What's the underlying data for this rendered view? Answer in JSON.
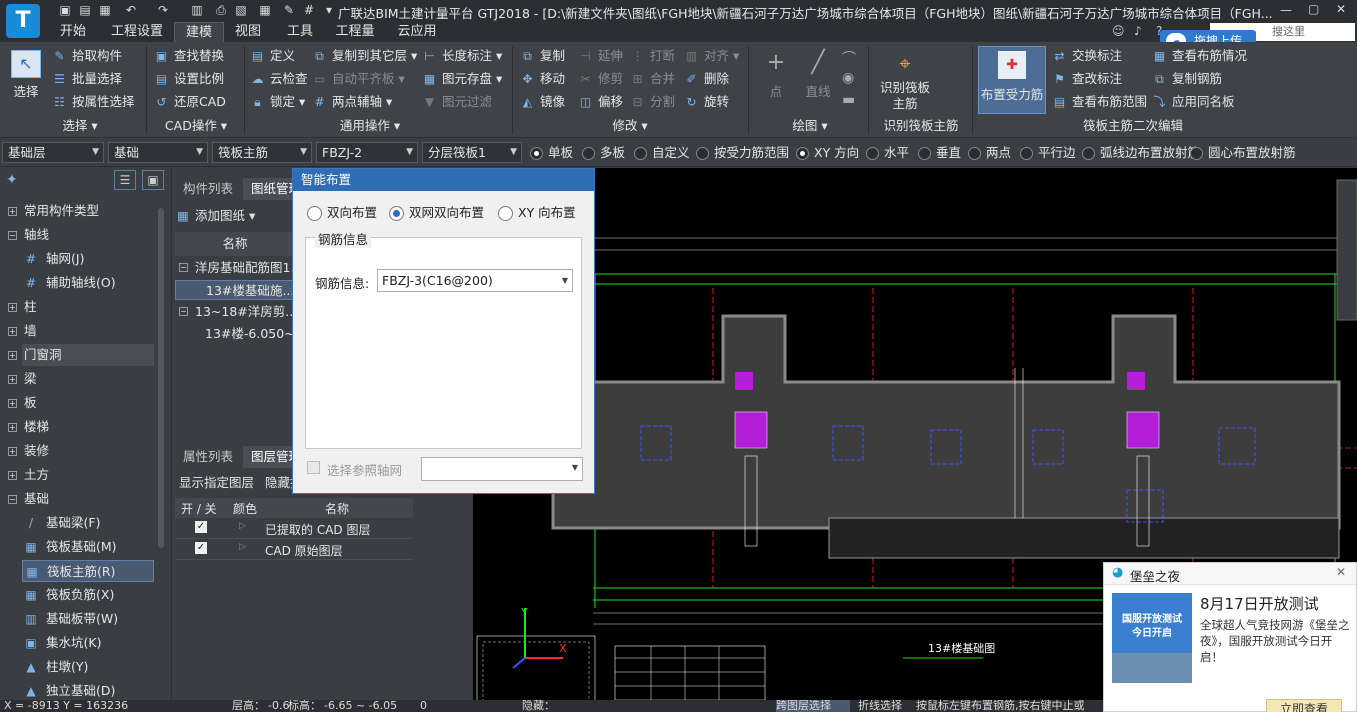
{
  "window": {
    "app_icon": "T",
    "title": "广联达BIM土建计量平台 GTJ2018 - [D:\\新建文件夹\\图纸\\FGH地块\\新疆石河子万达广场城市综合体项目（FGH地块）图纸\\新疆石河子万达广场城市综合体项目（FGH..."
  },
  "menu": {
    "tabs": [
      "开始",
      "工程设置",
      "建模",
      "视图",
      "工具",
      "工程量",
      "云应用"
    ],
    "active": "建模",
    "search_placeholder": "搜这里",
    "upload_label": "拖拽上传"
  },
  "ribbon": {
    "select": {
      "big": "选择",
      "group": "选择"
    },
    "select_items": [
      "拾取构件",
      "批量选择",
      "按属性选择"
    ],
    "cad_items": [
      "查找替换",
      "设置比例",
      "还原CAD"
    ],
    "cad_group": "CAD操作",
    "general_col1": [
      "定义",
      "云检查",
      "锁定"
    ],
    "general_col2": [
      "复制到其它层",
      "自动平齐板",
      "两点辅轴"
    ],
    "general_col3": [
      "长度标注",
      "图元存盘",
      "图元过滤"
    ],
    "general_group": "通用操作",
    "modify_col1": [
      "复制",
      "移动",
      "镜像"
    ],
    "modify_col2": [
      "延伸",
      "修剪",
      "偏移"
    ],
    "modify_col3": [
      "打断",
      "合并",
      "分割"
    ],
    "modify_col4": [
      "对齐",
      "删除",
      "旋转"
    ],
    "modify_group": "修改",
    "draw_items": [
      "点",
      "直线"
    ],
    "draw_group": "绘图",
    "identify_big": "识别筏板主筋",
    "identify_group": "识别筏板主筋",
    "layout_big": "布置受力筋",
    "edit_col1": [
      "交换标注",
      "查改标注",
      "查看布筋范围"
    ],
    "edit_col2": [
      "查看布筋情况",
      "复制钢筋",
      "应用同名板"
    ],
    "edit_group": "筏板主筋二次编辑"
  },
  "propbar": {
    "combos": [
      "基础层",
      "基础",
      "筏板主筋",
      "FBZJ-2",
      "分层筏板1"
    ],
    "radios": [
      "单板",
      "多板",
      "自定义",
      "按受力筋范围",
      "XY 方向",
      "水平",
      "垂直",
      "两点",
      "平行边",
      "弧线边布置放射筋",
      "圆心布置放射筋"
    ],
    "selected": [
      "单板",
      "XY 方向"
    ]
  },
  "nav": {
    "items": [
      {
        "label": "常用构件类型",
        "type": "group",
        "exp": "+"
      },
      {
        "label": "轴线",
        "type": "group",
        "exp": "−"
      },
      {
        "label": "轴网(J)",
        "type": "child",
        "icon": "#"
      },
      {
        "label": "辅助轴线(O)",
        "type": "child",
        "icon": "#"
      },
      {
        "label": "柱",
        "type": "group",
        "exp": "+"
      },
      {
        "label": "墙",
        "type": "group",
        "exp": "+"
      },
      {
        "label": "门窗洞",
        "type": "group",
        "exp": "+"
      },
      {
        "label": "梁",
        "type": "group",
        "exp": "+"
      },
      {
        "label": "板",
        "type": "group",
        "exp": "+"
      },
      {
        "label": "楼梯",
        "type": "group",
        "exp": "+"
      },
      {
        "label": "装修",
        "type": "group",
        "exp": "+"
      },
      {
        "label": "土方",
        "type": "group",
        "exp": "+"
      },
      {
        "label": "基础",
        "type": "group",
        "exp": "−"
      },
      {
        "label": "基础梁(F)",
        "type": "child",
        "icon": "/"
      },
      {
        "label": "筏板基础(M)",
        "type": "child",
        "icon": "▦"
      },
      {
        "label": "筏板主筋(R)",
        "type": "child",
        "icon": "▦"
      },
      {
        "label": "筏板负筋(X)",
        "type": "child",
        "icon": "▦"
      },
      {
        "label": "基础板带(W)",
        "type": "child",
        "icon": "▥"
      },
      {
        "label": "集水坑(K)",
        "type": "child",
        "icon": "▣"
      },
      {
        "label": "柱墩(Y)",
        "type": "child",
        "icon": "▲"
      },
      {
        "label": "独立基础(D)",
        "type": "child",
        "icon": "▲"
      }
    ],
    "selected": "筏板主筋(R)",
    "highlighted": "门窗洞"
  },
  "mid": {
    "top_tabs": [
      "构件列表",
      "图纸管理"
    ],
    "add_drawing": "添加图纸",
    "col_header": "名称",
    "tree": [
      {
        "label": "洋房基础配筋图1...",
        "indent": 0,
        "exp": "−"
      },
      {
        "label": "13#楼基础施...",
        "indent": 1,
        "sel": true
      },
      {
        "label": "13~18#洋房剪...",
        "indent": 0,
        "exp": "−"
      },
      {
        "label": "13#楼-6.050~...",
        "indent": 1
      }
    ],
    "bottom_tabs": [
      "属性列表",
      "图层管理"
    ],
    "layer_toolbar": [
      "显示指定图层",
      "隐藏指"
    ],
    "layer_headers": [
      "开 / 关",
      "颜色",
      "名称"
    ],
    "layers": [
      "已提取的 CAD 图层",
      "CAD 原始图层"
    ]
  },
  "dialog": {
    "title": "智能布置",
    "radios": [
      "双向布置",
      "双网双向布置",
      "XY 向布置"
    ],
    "selected": "双网双向布置",
    "group_title": "钢筋信息",
    "field_label": "钢筋信息:",
    "field_value": "FBZJ-3(C16@200)",
    "checkbox_label": "选择参照轴网"
  },
  "cad": {
    "plan_label": "13#楼基础图",
    "axis_y": "Y",
    "axis_x": "X"
  },
  "popup": {
    "header": "堡垒之夜",
    "headline": "8月17日开放测试",
    "body": "全球超人气竞技网游《堡垒之夜》，国服开放测试今日开启！",
    "button": "立即查看",
    "banner_text": "国服开放测试 今日开启"
  },
  "status": {
    "coords": "X = -8913 Y = 163236",
    "floor_height_label": "层高：",
    "floor_height": "-0.6",
    "elev_label": "标高：",
    "elev": "-6.65 ~ -6.05",
    "zero": "0",
    "hidden_label": "隐藏：",
    "cross_layer": "跨图层选择",
    "fold_select": "折线选择",
    "hint": "按鼠标左键布置钢筋,按右键中止或"
  },
  "colors": {
    "accent": "#2f6db5",
    "cad_green": "#19e619",
    "cad_magenta": "#b31fd9",
    "cad_red": "#ff2a2a"
  }
}
